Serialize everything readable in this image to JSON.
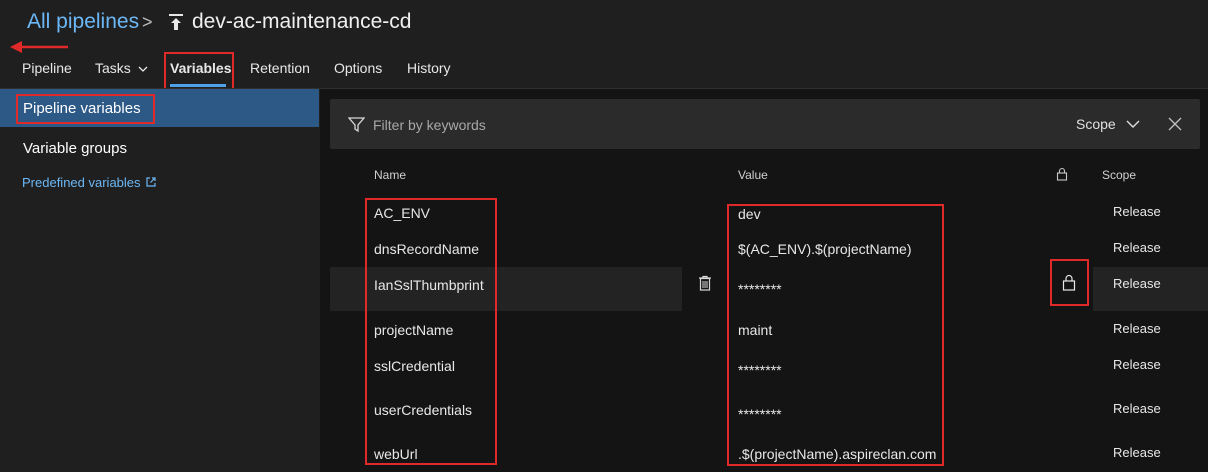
{
  "breadcrumb": {
    "root_label": "All pipelines",
    "separator": ">",
    "pipeline_name": "dev-ac-maintenance-cd"
  },
  "tabs": [
    {
      "label": "Pipeline"
    },
    {
      "label": "Tasks"
    },
    {
      "label": "Variables",
      "active": true
    },
    {
      "label": "Retention"
    },
    {
      "label": "Options"
    },
    {
      "label": "History"
    }
  ],
  "sidebar": {
    "items": [
      {
        "label": "Pipeline variables",
        "selected": true
      },
      {
        "label": "Variable groups"
      }
    ],
    "predefined_link": "Predefined variables"
  },
  "filter": {
    "placeholder": "Filter by keywords",
    "scope_label": "Scope"
  },
  "table": {
    "headers": {
      "name": "Name",
      "value": "Value",
      "scope": "Scope"
    },
    "rows": [
      {
        "name": "AC_ENV",
        "value": "dev",
        "scope": "Release"
      },
      {
        "name": "dnsRecordName",
        "value": "$(AC_ENV).$(projectName)",
        "scope": "Release"
      },
      {
        "name": "IanSslThumbprint",
        "value": "********",
        "scope": "Release",
        "secret": true
      },
      {
        "name": "projectName",
        "value": "maint",
        "scope": "Release"
      },
      {
        "name": "sslCredential",
        "value": "********",
        "scope": "Release"
      },
      {
        "name": "userCredentials",
        "value": "********",
        "scope": "Release"
      },
      {
        "name": "webUrl",
        "value": ".$(projectName).aspireclan.com",
        "scope": "Release"
      }
    ]
  },
  "colors": {
    "link": "#6cb8f6",
    "selected_bg": "#2d5987",
    "highlight_red": "#e02a2a",
    "tab_underline": "#4ea1e8"
  }
}
